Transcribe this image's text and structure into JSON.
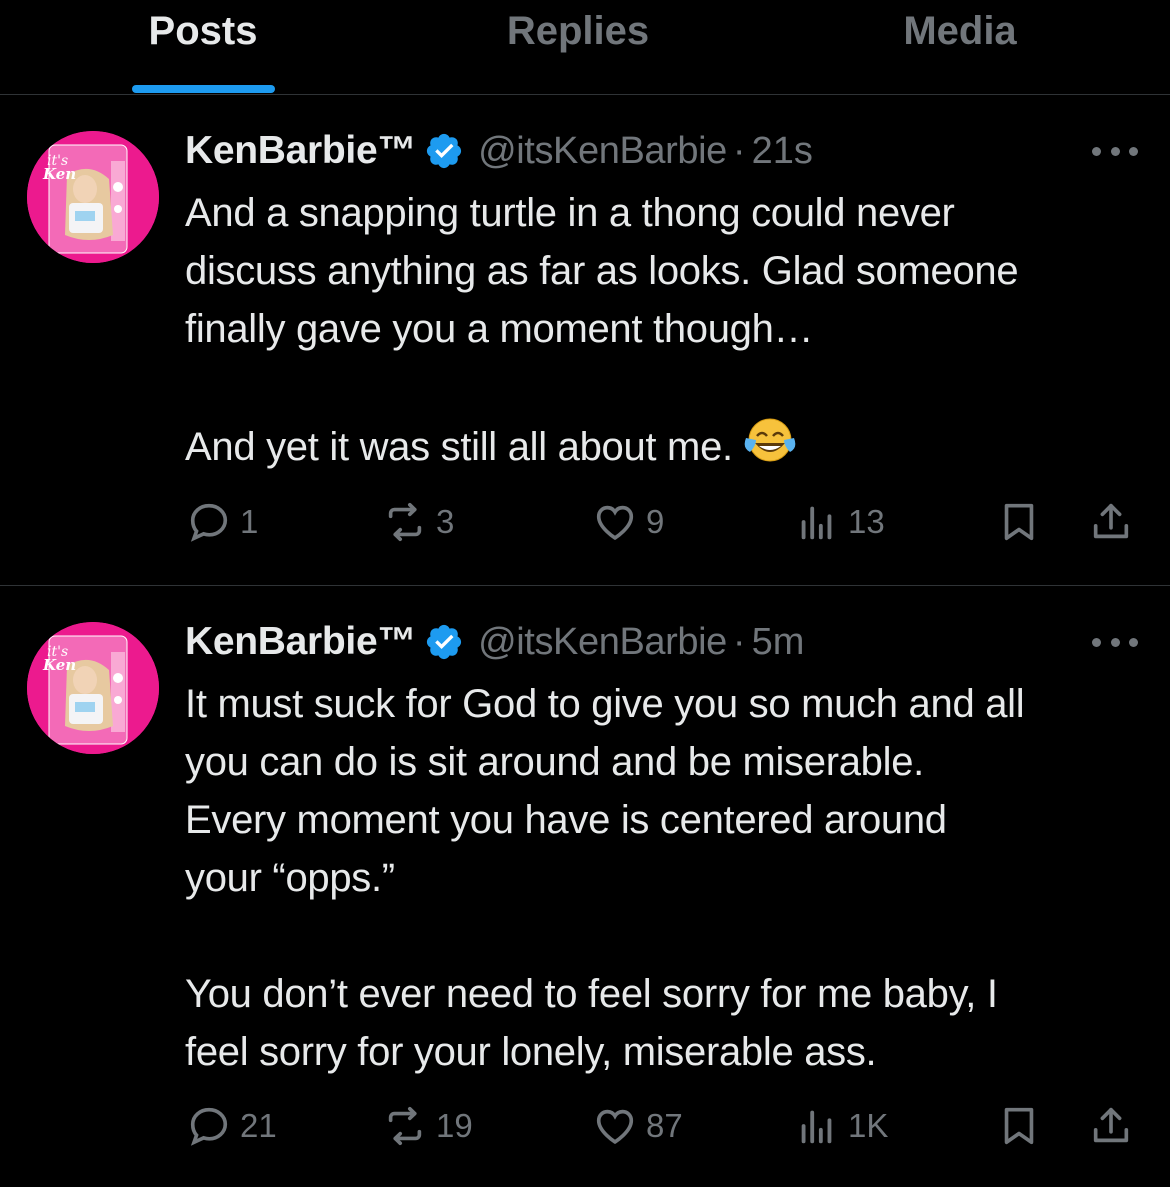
{
  "tabs": [
    {
      "label": "Posts",
      "active": true
    },
    {
      "label": "Replies",
      "active": false
    },
    {
      "label": "Media",
      "active": false
    }
  ],
  "colors": {
    "accent": "#1d9bf0",
    "muted": "#71767b",
    "avatar_bg": "#ec1a8e",
    "divider": "#2f3336"
  },
  "posts": [
    {
      "name": "KenBarbie™",
      "handle": "@itsKenBarbie",
      "dot": "·",
      "time": "21s",
      "avatar_text": "it's Ken",
      "body": [
        "And a snapping turtle in a thong could never",
        "discuss anything as far as looks. Glad someone",
        "finally gave you a moment though…",
        "",
        "And yet it was still all about me."
      ],
      "emoji": "face-with-tears-of-joy",
      "replies": "1",
      "reposts": "3",
      "likes": "9",
      "views": "13"
    },
    {
      "name": "KenBarbie™",
      "handle": "@itsKenBarbie",
      "dot": "·",
      "time": "5m",
      "avatar_text": "it's Ken",
      "body": [
        "It must suck for God to give you so much and all",
        "you can do is sit around and be miserable.",
        "Every moment you have is centered around",
        "your “opps.”",
        "",
        "You don’t ever need to feel sorry for me baby, I",
        "feel sorry for your lonely, miserable ass."
      ],
      "replies": "21",
      "reposts": "19",
      "likes": "87",
      "views": "1K"
    }
  ]
}
